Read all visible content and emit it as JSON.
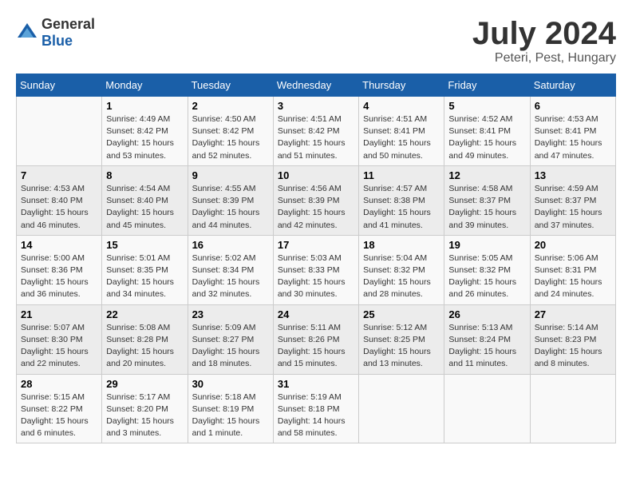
{
  "logo": {
    "general": "General",
    "blue": "Blue"
  },
  "title": "July 2024",
  "location": "Peteri, Pest, Hungary",
  "headers": [
    "Sunday",
    "Monday",
    "Tuesday",
    "Wednesday",
    "Thursday",
    "Friday",
    "Saturday"
  ],
  "weeks": [
    [
      {
        "day": "",
        "sunrise": "",
        "sunset": "",
        "daylight": ""
      },
      {
        "day": "1",
        "sunrise": "Sunrise: 4:49 AM",
        "sunset": "Sunset: 8:42 PM",
        "daylight": "Daylight: 15 hours and 53 minutes."
      },
      {
        "day": "2",
        "sunrise": "Sunrise: 4:50 AM",
        "sunset": "Sunset: 8:42 PM",
        "daylight": "Daylight: 15 hours and 52 minutes."
      },
      {
        "day": "3",
        "sunrise": "Sunrise: 4:51 AM",
        "sunset": "Sunset: 8:42 PM",
        "daylight": "Daylight: 15 hours and 51 minutes."
      },
      {
        "day": "4",
        "sunrise": "Sunrise: 4:51 AM",
        "sunset": "Sunset: 8:41 PM",
        "daylight": "Daylight: 15 hours and 50 minutes."
      },
      {
        "day": "5",
        "sunrise": "Sunrise: 4:52 AM",
        "sunset": "Sunset: 8:41 PM",
        "daylight": "Daylight: 15 hours and 49 minutes."
      },
      {
        "day": "6",
        "sunrise": "Sunrise: 4:53 AM",
        "sunset": "Sunset: 8:41 PM",
        "daylight": "Daylight: 15 hours and 47 minutes."
      }
    ],
    [
      {
        "day": "7",
        "sunrise": "Sunrise: 4:53 AM",
        "sunset": "Sunset: 8:40 PM",
        "daylight": "Daylight: 15 hours and 46 minutes."
      },
      {
        "day": "8",
        "sunrise": "Sunrise: 4:54 AM",
        "sunset": "Sunset: 8:40 PM",
        "daylight": "Daylight: 15 hours and 45 minutes."
      },
      {
        "day": "9",
        "sunrise": "Sunrise: 4:55 AM",
        "sunset": "Sunset: 8:39 PM",
        "daylight": "Daylight: 15 hours and 44 minutes."
      },
      {
        "day": "10",
        "sunrise": "Sunrise: 4:56 AM",
        "sunset": "Sunset: 8:39 PM",
        "daylight": "Daylight: 15 hours and 42 minutes."
      },
      {
        "day": "11",
        "sunrise": "Sunrise: 4:57 AM",
        "sunset": "Sunset: 8:38 PM",
        "daylight": "Daylight: 15 hours and 41 minutes."
      },
      {
        "day": "12",
        "sunrise": "Sunrise: 4:58 AM",
        "sunset": "Sunset: 8:37 PM",
        "daylight": "Daylight: 15 hours and 39 minutes."
      },
      {
        "day": "13",
        "sunrise": "Sunrise: 4:59 AM",
        "sunset": "Sunset: 8:37 PM",
        "daylight": "Daylight: 15 hours and 37 minutes."
      }
    ],
    [
      {
        "day": "14",
        "sunrise": "Sunrise: 5:00 AM",
        "sunset": "Sunset: 8:36 PM",
        "daylight": "Daylight: 15 hours and 36 minutes."
      },
      {
        "day": "15",
        "sunrise": "Sunrise: 5:01 AM",
        "sunset": "Sunset: 8:35 PM",
        "daylight": "Daylight: 15 hours and 34 minutes."
      },
      {
        "day": "16",
        "sunrise": "Sunrise: 5:02 AM",
        "sunset": "Sunset: 8:34 PM",
        "daylight": "Daylight: 15 hours and 32 minutes."
      },
      {
        "day": "17",
        "sunrise": "Sunrise: 5:03 AM",
        "sunset": "Sunset: 8:33 PM",
        "daylight": "Daylight: 15 hours and 30 minutes."
      },
      {
        "day": "18",
        "sunrise": "Sunrise: 5:04 AM",
        "sunset": "Sunset: 8:32 PM",
        "daylight": "Daylight: 15 hours and 28 minutes."
      },
      {
        "day": "19",
        "sunrise": "Sunrise: 5:05 AM",
        "sunset": "Sunset: 8:32 PM",
        "daylight": "Daylight: 15 hours and 26 minutes."
      },
      {
        "day": "20",
        "sunrise": "Sunrise: 5:06 AM",
        "sunset": "Sunset: 8:31 PM",
        "daylight": "Daylight: 15 hours and 24 minutes."
      }
    ],
    [
      {
        "day": "21",
        "sunrise": "Sunrise: 5:07 AM",
        "sunset": "Sunset: 8:30 PM",
        "daylight": "Daylight: 15 hours and 22 minutes."
      },
      {
        "day": "22",
        "sunrise": "Sunrise: 5:08 AM",
        "sunset": "Sunset: 8:28 PM",
        "daylight": "Daylight: 15 hours and 20 minutes."
      },
      {
        "day": "23",
        "sunrise": "Sunrise: 5:09 AM",
        "sunset": "Sunset: 8:27 PM",
        "daylight": "Daylight: 15 hours and 18 minutes."
      },
      {
        "day": "24",
        "sunrise": "Sunrise: 5:11 AM",
        "sunset": "Sunset: 8:26 PM",
        "daylight": "Daylight: 15 hours and 15 minutes."
      },
      {
        "day": "25",
        "sunrise": "Sunrise: 5:12 AM",
        "sunset": "Sunset: 8:25 PM",
        "daylight": "Daylight: 15 hours and 13 minutes."
      },
      {
        "day": "26",
        "sunrise": "Sunrise: 5:13 AM",
        "sunset": "Sunset: 8:24 PM",
        "daylight": "Daylight: 15 hours and 11 minutes."
      },
      {
        "day": "27",
        "sunrise": "Sunrise: 5:14 AM",
        "sunset": "Sunset: 8:23 PM",
        "daylight": "Daylight: 15 hours and 8 minutes."
      }
    ],
    [
      {
        "day": "28",
        "sunrise": "Sunrise: 5:15 AM",
        "sunset": "Sunset: 8:22 PM",
        "daylight": "Daylight: 15 hours and 6 minutes."
      },
      {
        "day": "29",
        "sunrise": "Sunrise: 5:17 AM",
        "sunset": "Sunset: 8:20 PM",
        "daylight": "Daylight: 15 hours and 3 minutes."
      },
      {
        "day": "30",
        "sunrise": "Sunrise: 5:18 AM",
        "sunset": "Sunset: 8:19 PM",
        "daylight": "Daylight: 15 hours and 1 minute."
      },
      {
        "day": "31",
        "sunrise": "Sunrise: 5:19 AM",
        "sunset": "Sunset: 8:18 PM",
        "daylight": "Daylight: 14 hours and 58 minutes."
      },
      {
        "day": "",
        "sunrise": "",
        "sunset": "",
        "daylight": ""
      },
      {
        "day": "",
        "sunrise": "",
        "sunset": "",
        "daylight": ""
      },
      {
        "day": "",
        "sunrise": "",
        "sunset": "",
        "daylight": ""
      }
    ]
  ]
}
